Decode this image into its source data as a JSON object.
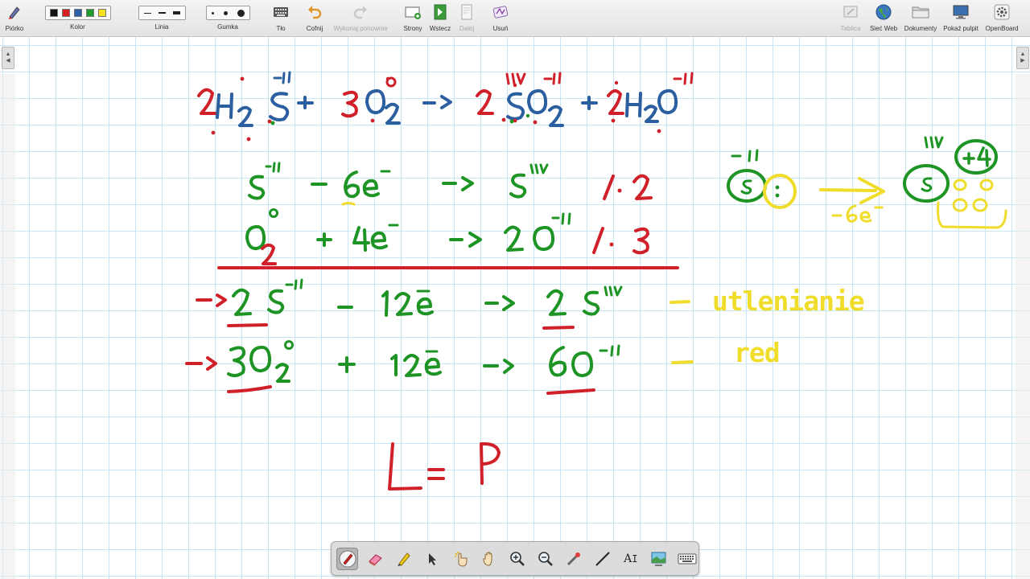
{
  "toolbar": {
    "pen": "Piórko",
    "color": "Kolor",
    "line": "Linia",
    "eraser": "Gumka",
    "background": "Tło",
    "undo": "Cofnij",
    "redo": "Wykonaj ponownie",
    "pages": "Strony",
    "back": "Wstecz",
    "next": "Dalej",
    "delete": "Usuń",
    "board": "Tablica",
    "web": "Sieć Web",
    "documents": "Dokumenty",
    "desktop": "Pokaż pulpit",
    "openboard": "OpenBoard"
  },
  "colors": {
    "swatches": [
      "#111111",
      "#d62020",
      "#2f5fa8",
      "#1f9a2a",
      "#f5e020"
    ],
    "ink_red": "#d0202a",
    "ink_blue": "#2c5fa0",
    "ink_green": "#1e9424",
    "ink_yellow": "#f0dc2a",
    "grid": "#c9e7f2"
  },
  "board_text": {
    "oxidation_label": "utlenianie",
    "reduction_label": "red"
  },
  "bottom_tools": [
    "pen-tool",
    "eraser-tool",
    "highlighter-tool",
    "selector-tool",
    "interact-tool",
    "hand-tool",
    "zoom-in-tool",
    "zoom-out-tool",
    "laser-pointer-tool",
    "line-tool",
    "text-tool",
    "capture-tool",
    "virtual-keyboard-tool"
  ]
}
